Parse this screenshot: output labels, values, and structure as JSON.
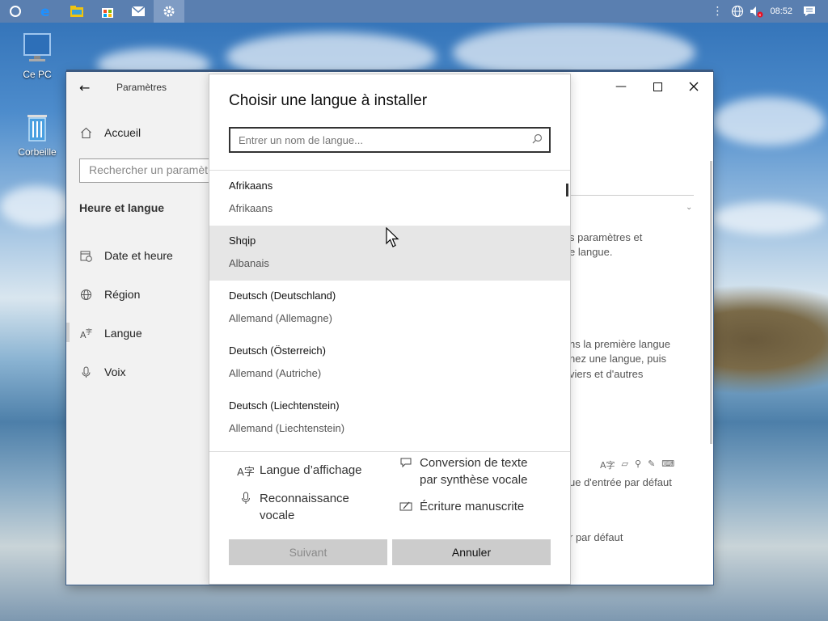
{
  "desktop": {
    "icons": [
      {
        "label": "Ce PC"
      },
      {
        "label": "Corbeille"
      }
    ]
  },
  "taskbar": {
    "apps": [
      "cortana-icon",
      "edge-icon",
      "file-explorer-icon",
      "store-icon",
      "mail-icon",
      "settings-icon"
    ],
    "active_app": "settings-icon",
    "time": "08:52"
  },
  "settings_window": {
    "title": "Paramètres",
    "home_label": "Accueil",
    "search_placeholder": "Rechercher un paramètre",
    "section_heading": "Heure et langue",
    "nav_items": [
      {
        "label": "Date et heure",
        "icon": "calendar-clock-icon"
      },
      {
        "label": "Région",
        "icon": "globe-icon"
      },
      {
        "label": "Langue",
        "icon": "language-icon"
      },
      {
        "label": "Voix",
        "icon": "microphone-icon"
      }
    ],
    "background_text": {
      "line1": "s paramètres et",
      "line2": "e langue.",
      "line3": "ns la première langue",
      "line4": "nez une langue, puis",
      "line5": "viers et d'autres",
      "line6": "ue d'entrée par défaut",
      "line7": "r par défaut"
    }
  },
  "dialog": {
    "title": "Choisir une langue à installer",
    "search_placeholder": "Entrer un nom de langue...",
    "languages": [
      {
        "native": "Afrikaans",
        "french": "Afrikaans"
      },
      {
        "native": "Shqip",
        "french": "Albanais"
      },
      {
        "native": "Deutsch (Deutschland)",
        "french": "Allemand (Allemagne)"
      },
      {
        "native": "Deutsch (Österreich)",
        "french": "Allemand (Autriche)"
      },
      {
        "native": "Deutsch (Liechtenstein)",
        "french": "Allemand (Liechtenstein)"
      }
    ],
    "hovered_index": 1,
    "features": {
      "display": "Langue d’affichage",
      "tts_line1": "Conversion de texte",
      "tts_line2": "par synthèse vocale",
      "speech_line1": "Reconnaissance",
      "speech_line2": "vocale",
      "handwriting": "Écriture manuscrite"
    },
    "next_label": "Suivant",
    "cancel_label": "Annuler"
  },
  "colors": {
    "taskbar": "#5a7fb0",
    "sidebar": "#f2f2f2",
    "hover_row": "#e6e6e6",
    "button": "#cccccc"
  }
}
